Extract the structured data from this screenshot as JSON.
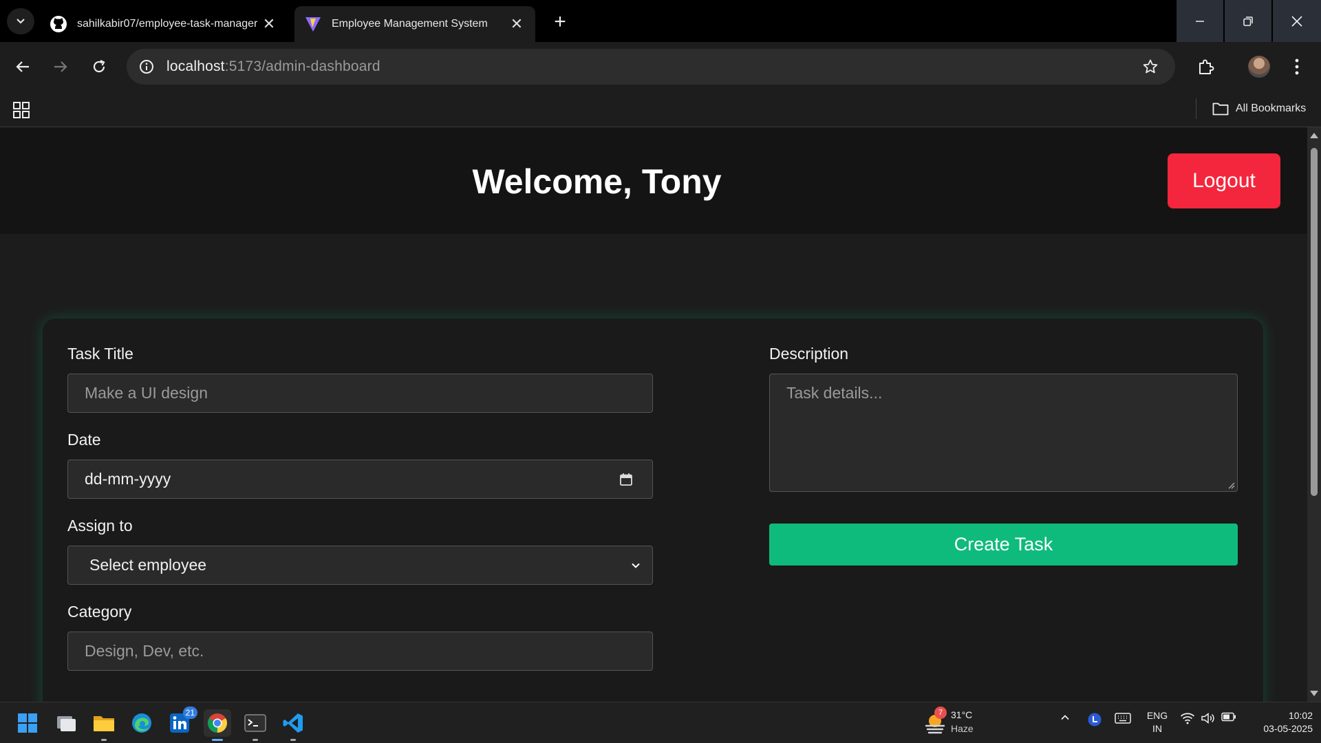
{
  "browser": {
    "tabs": [
      {
        "title": "sahilkabir07/employee-task-manager",
        "icon": "github-icon",
        "active": false
      },
      {
        "title": "Employee Management System",
        "icon": "vite-icon",
        "active": true
      }
    ],
    "address": {
      "host": "localhost",
      "rest": ":5173/admin-dashboard"
    },
    "bookmarks_label": "All Bookmarks"
  },
  "header": {
    "welcome": "Welcome, Tony",
    "logout_label": "Logout"
  },
  "form": {
    "task_title": {
      "label": "Task Title",
      "placeholder": "Make a UI design"
    },
    "date": {
      "label": "Date",
      "value": "dd-mm-yyyy"
    },
    "assign_to": {
      "label": "Assign to",
      "selected": "Select employee"
    },
    "category": {
      "label": "Category",
      "placeholder": "Design, Dev, etc."
    },
    "description": {
      "label": "Description",
      "placeholder": "Task details..."
    },
    "create_label": "Create Task"
  },
  "taskbar": {
    "linkedin_badge": "21",
    "weather": {
      "temp": "31°C",
      "condition": "Haze",
      "badge": "7"
    },
    "language": {
      "line1": "ENG",
      "line2": "IN"
    },
    "clock": {
      "time": "10:02",
      "date": "03-05-2025"
    }
  },
  "colors": {
    "accent_green": "#0fbb7c",
    "logout_red": "#f4263d",
    "page_bg": "#1c1c1c",
    "header_bg": "#141414"
  }
}
